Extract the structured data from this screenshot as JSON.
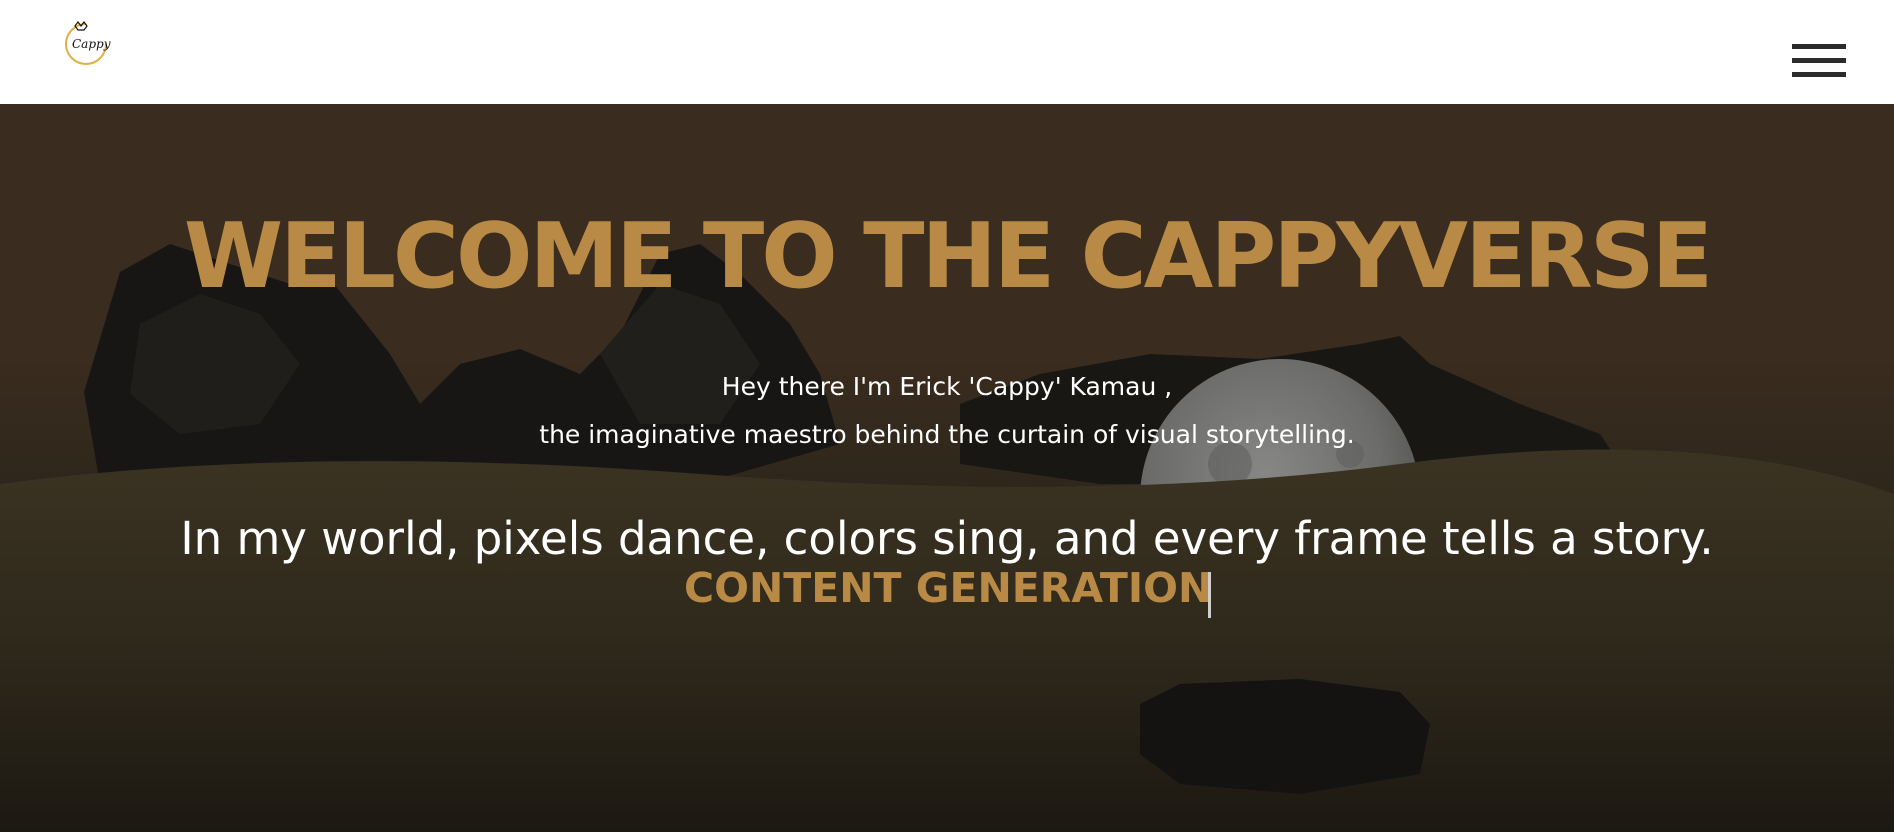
{
  "header": {
    "logo_text": "Cappy",
    "menu_icon": "hamburger-menu-icon"
  },
  "hero": {
    "title": "WELCOME TO THE CAPPYVERSE",
    "intro_line1": "Hey there I'm Erick 'Cappy' Kamau ,",
    "intro_line2": "the imaginative maestro behind the curtain of visual storytelling.",
    "tagline": "In my world, pixels dance, colors sing, and every frame tells a story.",
    "typed_text": "CONTENT GENERATION"
  },
  "colors": {
    "accent": "#b98a45",
    "hero_overlay": "#3a2c1f",
    "text": "#ffffff",
    "menu": "#2b2b2b"
  }
}
